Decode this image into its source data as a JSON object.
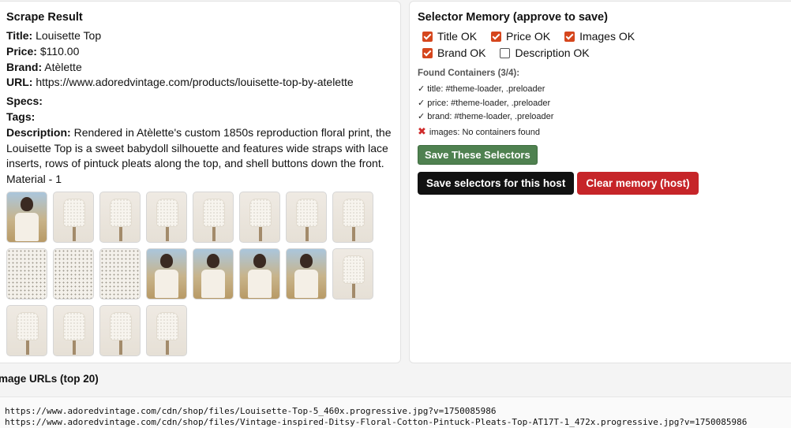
{
  "scrape": {
    "heading": "Scrape Result",
    "title_label": "Title:",
    "title_value": "Louisette Top",
    "price_label": "Price:",
    "price_value": "$110.00",
    "brand_label": "Brand:",
    "brand_value": "Atèlette",
    "url_label": "URL:",
    "url_value": "https://www.adoredvintage.com/products/louisette-top-by-atelette",
    "specs_label": "Specs:",
    "tags_label": "Tags:",
    "description_label": "Description:",
    "description_value": "Rendered in Atèlette's custom 1850s reproduction floral print, the Louisette Top is a sweet babydoll silhouette and features wide straps with lace inserts, rows of pintuck pleats along the top, and shell buttons down the front. Material - 1",
    "thumbnails": [
      {
        "kind": "model-photo"
      },
      {
        "kind": "dress-form-photo"
      },
      {
        "kind": "dress-form-photo"
      },
      {
        "kind": "dress-form-photo"
      },
      {
        "kind": "dress-form-photo"
      },
      {
        "kind": "dress-form-photo"
      },
      {
        "kind": "dress-form-photo"
      },
      {
        "kind": "dress-form-photo"
      },
      {
        "kind": "fabric-detail-photo"
      },
      {
        "kind": "fabric-detail-photo"
      },
      {
        "kind": "fabric-detail-photo"
      },
      {
        "kind": "model-photo"
      },
      {
        "kind": "model-photo"
      },
      {
        "kind": "model-photo"
      },
      {
        "kind": "model-photo"
      },
      {
        "kind": "dress-form-photo"
      },
      {
        "kind": "dress-form-photo"
      },
      {
        "kind": "dress-form-photo"
      },
      {
        "kind": "dress-form-photo"
      },
      {
        "kind": "dress-form-photo"
      }
    ]
  },
  "selector_memory": {
    "heading": "Selector Memory (approve to save)",
    "checkboxes": [
      {
        "label": "Title OK",
        "checked": true
      },
      {
        "label": "Price OK",
        "checked": true
      },
      {
        "label": "Images OK",
        "checked": true
      },
      {
        "label": "Brand OK",
        "checked": true
      },
      {
        "label": "Description OK",
        "checked": false
      }
    ],
    "found_title": "Found Containers (3/4):",
    "found": [
      {
        "mark": "✓",
        "text": "title: #theme-loader, .preloader"
      },
      {
        "mark": "✓",
        "text": "price: #theme-loader, .preloader"
      },
      {
        "mark": "✓",
        "text": "brand: #theme-loader, .preloader"
      },
      {
        "mark": "✖",
        "text": "images: No containers found"
      }
    ],
    "save_these_label": "Save These Selectors",
    "save_host_label": "Save selectors for this host",
    "clear_memory_label": "Clear memory (host)",
    "colors": {
      "checkbox": "#d5461d",
      "green_button": "#4f8150",
      "black_button": "#111111",
      "red_button": "#c62529"
    }
  },
  "image_urls": {
    "heading": "mage URLs (top 20)",
    "lines": [
      "https://www.adoredvintage.com/cdn/shop/files/Louisette-Top-5_460x.progressive.jpg?v=1750085986",
      "https://www.adoredvintage.com/cdn/shop/files/Vintage-inspired-Ditsy-Floral-Cotton-Pintuck-Pleats-Top-AT17T-1_472x.progressive.jpg?v=1750085986"
    ]
  }
}
